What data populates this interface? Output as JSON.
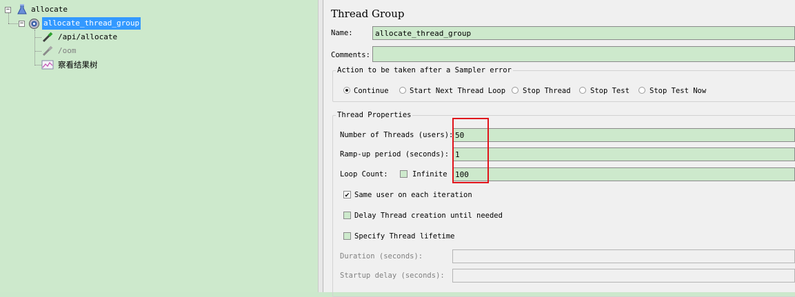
{
  "tree": {
    "root_label": "allocate",
    "thread_group_label": "allocate_thread_group",
    "children": [
      {
        "label": "/api/allocate"
      },
      {
        "label": "/oom"
      },
      {
        "label": "察看结果树"
      }
    ]
  },
  "editor": {
    "title": "Thread Group",
    "name_label": "Name:",
    "name_value": "allocate_thread_group",
    "comments_label": "Comments:",
    "comments_value": "",
    "sampler_error": {
      "legend": "Action to be taken after a Sampler error",
      "options": [
        "Continue",
        "Start Next Thread Loop",
        "Stop Thread",
        "Stop Test",
        "Stop Test Now"
      ],
      "selected": "Continue"
    },
    "thread_props": {
      "legend": "Thread Properties",
      "threads_label": "Number of Threads (users):",
      "threads_value": "50",
      "rampup_label": "Ramp-up period (seconds):",
      "rampup_value": "1",
      "loop_label": "Loop Count:",
      "infinite_label": "Infinite",
      "infinite_checked": false,
      "loop_value": "100",
      "same_user_label": "Same user on each iteration",
      "same_user_checked": true,
      "delay_label": "Delay Thread creation until needed",
      "delay_checked": false,
      "lifetime_label": "Specify Thread lifetime",
      "lifetime_checked": false,
      "duration_label": "Duration (seconds):",
      "duration_value": "",
      "startup_label": "Startup delay (seconds):",
      "startup_value": ""
    }
  },
  "colors": {
    "field_bg": "#cde9cc",
    "tree_bg": "#cde9cc",
    "selection": "#3399ff",
    "highlight_box": "#e0141b"
  }
}
